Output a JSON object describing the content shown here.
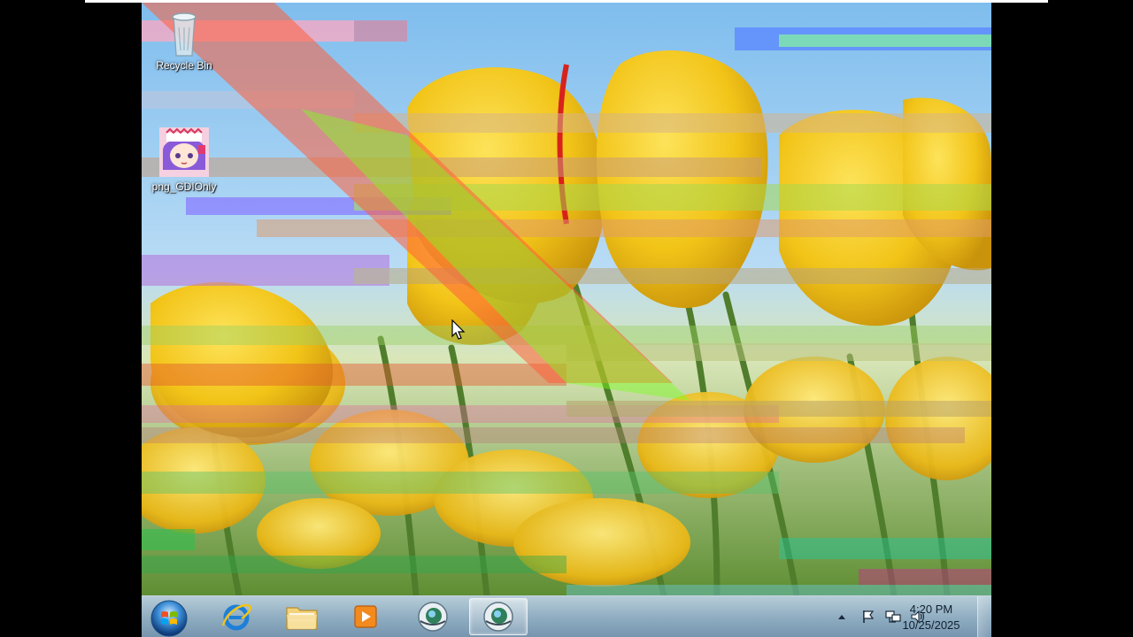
{
  "desktop": {
    "icons": [
      {
        "label": "Recycle Bin",
        "icon": "recycle-bin-icon"
      },
      {
        "label": "png_GDIOnly",
        "icon": "anime-character-icon"
      }
    ]
  },
  "taskbar": {
    "start": {
      "icon": "windows-orb-icon"
    },
    "pinned": [
      {
        "icon": "internet-explorer-icon"
      },
      {
        "icon": "file-explorer-icon"
      },
      {
        "icon": "media-player-icon"
      },
      {
        "icon": "globe-app-icon"
      },
      {
        "icon": "globe-app-icon",
        "active": true
      }
    ],
    "tray": {
      "icons": [
        "show-hidden-icons-arrow-icon",
        "action-center-flag-icon",
        "network-icon",
        "volume-icon"
      ],
      "clock": {
        "time": "4:20 PM",
        "date": "10/25/2025"
      }
    }
  },
  "colors": {
    "tulip_yellow": "#f2c418",
    "sky_blue": "#8fc6f0",
    "stem_green": "#4f7d2b",
    "taskbar": "#9db6cf"
  }
}
